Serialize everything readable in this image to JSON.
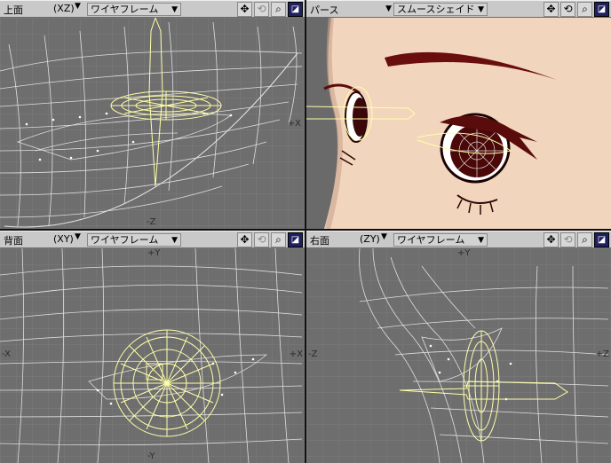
{
  "viewports": {
    "top": {
      "name": "上面",
      "axis": "(XZ)",
      "mode": "ワイヤフレーム",
      "labels": {
        "right": "+X",
        "bottom": "-Z"
      }
    },
    "persp": {
      "name": "パース",
      "axis": "",
      "mode": "スムースシェイド",
      "labels": {}
    },
    "back": {
      "name": "背面",
      "axis": "(XY)",
      "mode": "ワイヤフレーム",
      "labels": {
        "top": "+Y",
        "left": "-X",
        "right": "+X",
        "bottom": "-Y"
      }
    },
    "right": {
      "name": "右面",
      "axis": "(ZY)",
      "mode": "ワイヤフレーム",
      "labels": {
        "top": "+Y",
        "left": "-Z",
        "right": "+Z"
      }
    }
  },
  "tools": [
    "move-view-icon",
    "rotate-view-icon",
    "zoom-view-icon",
    "maximize-view-icon"
  ],
  "colors": {
    "background": "#6e6e6e",
    "grid": "#7a7a7a",
    "wire": "#e8e8e8",
    "selection": "#ffffa8",
    "skin": "#f2d5bd",
    "eyebrow": "#6a0d0d"
  }
}
